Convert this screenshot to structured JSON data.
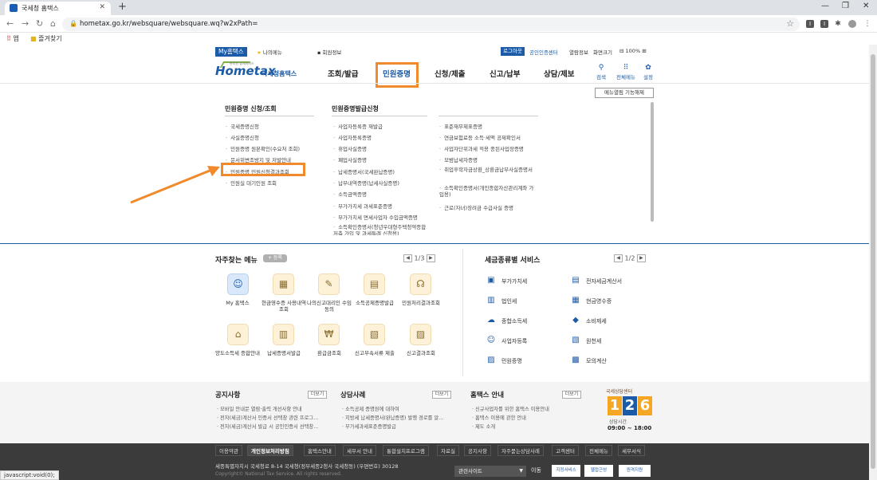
{
  "browser": {
    "tab_title": "국세청 홈택스",
    "url": "hometax.go.kr/websquare/websquare.wq?w2xPath=",
    "bookmarks": [
      "앱",
      "즐겨찾기"
    ],
    "status_text": "javascript:void(0);"
  },
  "util": {
    "my_hometax": "My홈택스",
    "my_menu": "나의메뉴",
    "member_info": "회원정보",
    "login": "로그아웃",
    "cert_center": "공인인증센터",
    "browser_info": "열람정보",
    "screen_size": "화면크기",
    "zoom": "100%"
  },
  "header": {
    "logo_text": "Hometax",
    "logo_name": "국세청홈택스",
    "logo_tagline": "편리한 납세서비스",
    "nav": [
      "조회/발급",
      "민원증명",
      "신청/제출",
      "신고/납부",
      "상담/제보"
    ],
    "icons": [
      {
        "label": "검색",
        "icon": "search-icon"
      },
      {
        "label": "전체메뉴",
        "icon": "grid-icon"
      },
      {
        "label": "설정",
        "icon": "gear-icon"
      }
    ]
  },
  "megamenu": {
    "pin_label": "메뉴열림 기능해제",
    "col1_title": "민원증명 신청/조회",
    "col2_title": "민원증명발급신청",
    "col1": [
      "국세증명신청",
      "사실증명신청",
      "민원증명 원본확인(수요처 조회)",
      "문서위변조방지 및 저발안내",
      "민원증명 민원신청결과조회",
      "민원실 대기인원 조회"
    ],
    "col2": [
      "사업자등록증 재발급",
      "사업자등록증명",
      "휴업사실증명",
      "폐업사실증명",
      "납세증명서(국세완납증명)",
      "납부내역증명(납세사실증명)",
      "소득금액증명",
      "부가가치세 과세표준증명",
      "부가가치세 면세사업자 수입금액증명",
      "소득확인증명서(청년우대형주택청약종합저축 가입 및 과세특례 신청용)"
    ],
    "col3": [
      "표준재무제표증명",
      "연금보험료등 소득·세액 공제확인서",
      "사업자단위과세 적용 종된사업장증명",
      "모범납세자증명",
      "취업후학자금상환_상환금납부사실증명서",
      "소득확인증명서(개인종합자산관리계좌 가입용)",
      "근로(자녀)장려금 수급사실 증명"
    ]
  },
  "favorites": {
    "title": "자주찾는 메뉴",
    "add_label": "+ 등록",
    "page": "1/3",
    "items": [
      {
        "label": "My 홈택스",
        "icon": "person-icon"
      },
      {
        "label": "현금영수증 사용내역조회",
        "icon": "receipt-icon"
      },
      {
        "label": "나의신고대리인 수임동의",
        "icon": "document-edit-icon"
      },
      {
        "label": "소득공제증명발급",
        "icon": "certificate-icon"
      },
      {
        "label": "민원처리결과조회",
        "icon": "headset-icon"
      },
      {
        "label": "양도소득세 종합안내",
        "icon": "house-icon"
      },
      {
        "label": "납세증명서발급",
        "icon": "document-icon"
      },
      {
        "label": "환급금조회",
        "icon": "refund-icon"
      },
      {
        "label": "신고부속서류 제출",
        "icon": "submit-icon"
      },
      {
        "label": "신고결과조회",
        "icon": "report-search-icon"
      }
    ]
  },
  "tax_services": {
    "title": "세금종류별 서비스",
    "page": "1/2",
    "items": [
      {
        "label": "부가가치세",
        "icon": "vat-icon"
      },
      {
        "label": "전자세금계산서",
        "icon": "invoice-icon"
      },
      {
        "label": "법인세",
        "icon": "corp-icon"
      },
      {
        "label": "현금영수증",
        "icon": "cash-receipt-icon"
      },
      {
        "label": "종합소득세",
        "icon": "income-icon"
      },
      {
        "label": "소비제세",
        "icon": "diamond-icon"
      },
      {
        "label": "사업자등록",
        "icon": "registration-icon"
      },
      {
        "label": "원천세",
        "icon": "withholding-icon"
      },
      {
        "label": "민원증명",
        "icon": "civil-icon"
      },
      {
        "label": "모의계산",
        "icon": "calculator-icon"
      }
    ]
  },
  "notices": {
    "more": "더보기",
    "sections": [
      {
        "title": "공지사항",
        "items": [
          "모바일 안내문 열람·출력 개선사항 안내",
          "전자(세금)계산서 인증서 선택창 관련 프로그...",
          "전자(세금)계산서 발급 시 공인인증서 선택창..."
        ]
      },
      {
        "title": "상담사례",
        "items": [
          "소득공제 증명원에 대하여",
          "지방세 납세증명서(완납증명) 발행 경로를 알...",
          "부가세과세표준증명발급"
        ]
      },
      {
        "title": "홈택스 안내",
        "items": [
          "신규사업자를 위한 홈택스 이용안내",
          "홈택스 이용에 관한 안내",
          "제도 소개"
        ]
      }
    ],
    "call_center": {
      "label": "국세상담센터",
      "digits": [
        "1",
        "2",
        "6"
      ],
      "hours_label": "상담시간",
      "hours": "09:00 ~ 18:00"
    }
  },
  "footer": {
    "links": [
      "이용약관",
      "개인정보처리방침",
      "홈택스안내",
      "세무서 안내",
      "통합설치프로그램",
      "자료실",
      "공지사항",
      "자주묻는상담사례",
      "고객센터",
      "전체메뉴",
      "세무서식"
    ],
    "address": "세종특별자치시 국세청로 8-14 국세청(정부세종2청사 국세청동) (우편번호) 30128",
    "copyright": "Copyright© National Tax Service. All rights reserved.",
    "related": "관련사이트",
    "go": "이동",
    "badges": [
      "지정서비스",
      "웹접근성",
      "원격지원"
    ]
  },
  "colors": {
    "brand": "#1c5ba7",
    "highlight": "#f08a2c",
    "footer_bg": "#3b3b3b"
  }
}
